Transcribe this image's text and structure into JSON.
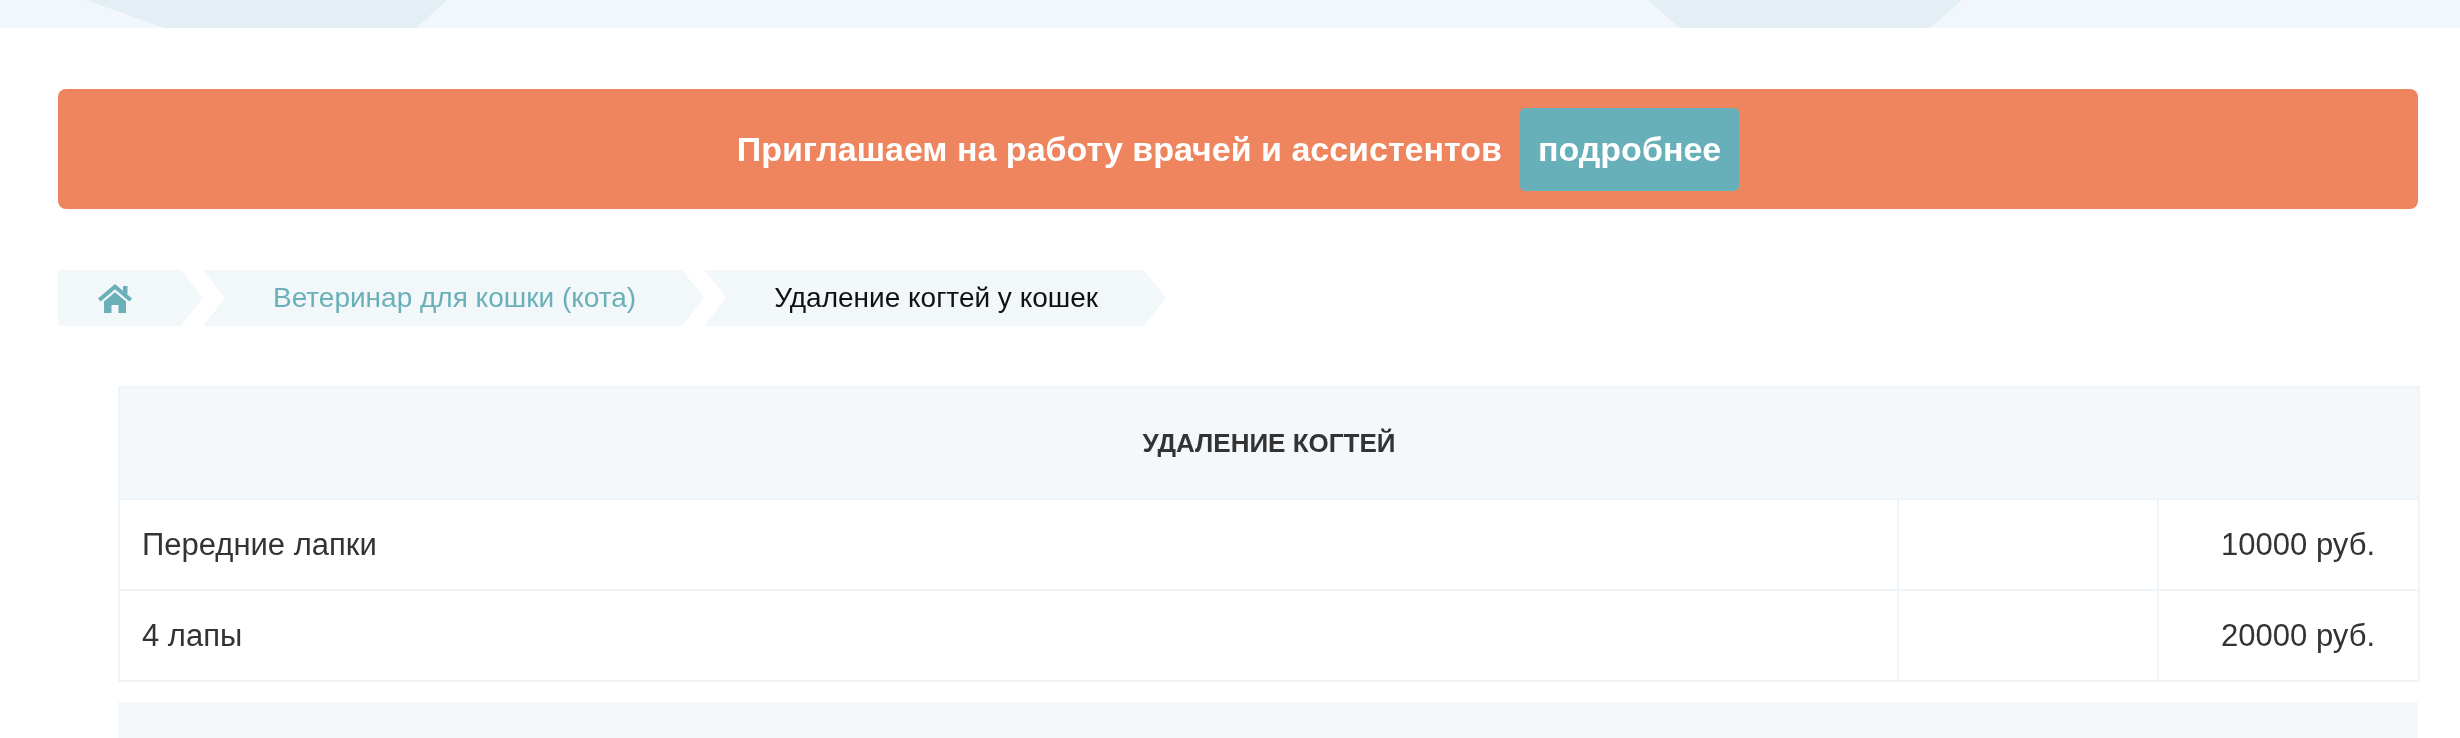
{
  "banner": {
    "text": "Приглашаем на работу врачей и ассистентов",
    "button": "подробнее"
  },
  "breadcrumbs": [
    {
      "kind": "home"
    },
    {
      "kind": "link",
      "label": "Ветеринар для кошки (кота)"
    },
    {
      "kind": "current",
      "label": "Удаление когтей у кошек"
    }
  ],
  "price_tables": [
    {
      "kind": "full",
      "title": "УДАЛЕНИЕ КОГТЕЙ",
      "rows": [
        {
          "service": "Передние лапки",
          "price": "10000 руб."
        },
        {
          "service": "4 лапы",
          "price": "20000 руб."
        }
      ]
    },
    {
      "kind": "cut_off"
    }
  ]
}
